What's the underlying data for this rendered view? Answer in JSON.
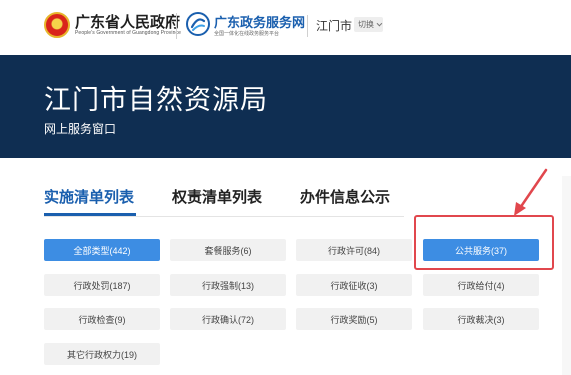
{
  "header": {
    "gov_title": "广东省人民政府",
    "gov_subtitle": "People's Government of Guangdong Province",
    "service_title": "广东政务服务网",
    "service_subtitle": "全国一体化在线政务服务平台",
    "city": "江门市",
    "switch_label": "切换"
  },
  "banner": {
    "title": "江门市自然资源局",
    "subtitle": "网上服务窗口"
  },
  "tabs": [
    {
      "label": "实施清单列表",
      "active": true
    },
    {
      "label": "权责清单列表",
      "active": false
    },
    {
      "label": "办件信息公示",
      "active": false
    }
  ],
  "categories": [
    {
      "label": "全部类型(442)",
      "selected": true
    },
    {
      "label": "套餐服务(6)",
      "selected": false
    },
    {
      "label": "行政许可(84)",
      "selected": false
    },
    {
      "label": "公共服务(37)",
      "selected": true,
      "highlighted": true
    },
    {
      "label": "行政处罚(187)",
      "selected": false
    },
    {
      "label": "行政强制(13)",
      "selected": false
    },
    {
      "label": "行政征收(3)",
      "selected": false
    },
    {
      "label": "行政给付(4)",
      "selected": false
    },
    {
      "label": "行政检查(9)",
      "selected": false
    },
    {
      "label": "行政确认(72)",
      "selected": false
    },
    {
      "label": "行政奖励(5)",
      "selected": false
    },
    {
      "label": "行政裁决(3)",
      "selected": false
    },
    {
      "label": "其它行政权力(19)",
      "selected": false
    }
  ],
  "colors": {
    "banner_bg": "#0f2e52",
    "accent": "#1a5fae",
    "selected_bg": "#3d8de3",
    "annotation": "#e1474d"
  },
  "icons": [
    "emblem-icon",
    "service-logo-icon",
    "chevron-down-icon",
    "arrow-annotation-icon"
  ]
}
